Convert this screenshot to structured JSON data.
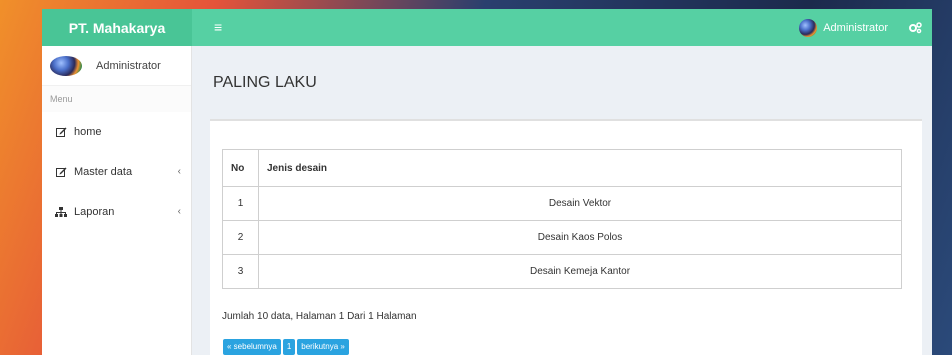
{
  "brand": "PT. Mahakarya",
  "topbar": {
    "menu_icon": "hamburger-icon",
    "user_name": "Administrator",
    "settings_icon": "gears-icon"
  },
  "sidebar": {
    "user_name": "Administrator",
    "menu_header": "Menu",
    "items": [
      {
        "label": "home",
        "icon": "edit-icon",
        "has_submenu": false
      },
      {
        "label": "Master data",
        "icon": "edit-icon",
        "has_submenu": true
      },
      {
        "label": "Laporan",
        "icon": "sitemap-icon",
        "has_submenu": true
      }
    ],
    "chevron": "‹"
  },
  "main": {
    "title": "PALING LAKU",
    "table": {
      "headers": [
        "No",
        "Jenis desain"
      ],
      "rows": [
        {
          "no": "1",
          "name": "Desain Vektor"
        },
        {
          "no": "2",
          "name": "Desain Kaos Polos"
        },
        {
          "no": "3",
          "name": "Desain Kemeja Kantor"
        }
      ]
    },
    "summary": "Jumlah 10 data, Halaman 1 Dari 1 Halaman",
    "pagination": {
      "prev": "« sebelumnya",
      "page": "1",
      "next": "berikutnya »"
    }
  },
  "colors": {
    "topbar": "#56d0a3",
    "brand_bg": "#49c596",
    "pager_button": "#2aa3e0",
    "content_bg": "#ecf0f5"
  }
}
